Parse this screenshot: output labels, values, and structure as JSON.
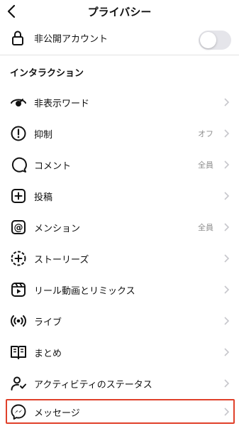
{
  "header": {
    "title": "プライバシー",
    "back_icon": "chevron-left-icon"
  },
  "private_account": {
    "label": "非公開アカウント",
    "icon": "lock-icon",
    "toggle_on": false
  },
  "section": {
    "title": "インタラクション"
  },
  "items": [
    {
      "label": "非表示ワード",
      "value": "",
      "icon": "eye-slash-icon"
    },
    {
      "label": "抑制",
      "value": "オフ",
      "icon": "alert-circle-icon"
    },
    {
      "label": "コメント",
      "value": "全員",
      "icon": "comment-icon"
    },
    {
      "label": "投稿",
      "value": "",
      "icon": "plus-square-icon"
    },
    {
      "label": "メンション",
      "value": "全員",
      "icon": "at-icon"
    },
    {
      "label": "ストーリーズ",
      "value": "",
      "icon": "story-plus-icon"
    },
    {
      "label": "リール動画とリミックス",
      "value": "",
      "icon": "reels-icon"
    },
    {
      "label": "ライブ",
      "value": "",
      "icon": "live-icon"
    },
    {
      "label": "まとめ",
      "value": "",
      "icon": "guides-icon"
    },
    {
      "label": "アクティビティのステータス",
      "value": "",
      "icon": "activity-status-icon"
    },
    {
      "label": "メッセージ",
      "value": "",
      "icon": "messenger-icon"
    }
  ],
  "colors": {
    "highlight": "#e0402a",
    "chevron": "#c7c7cc",
    "secondary_text": "#8e8e8e"
  }
}
